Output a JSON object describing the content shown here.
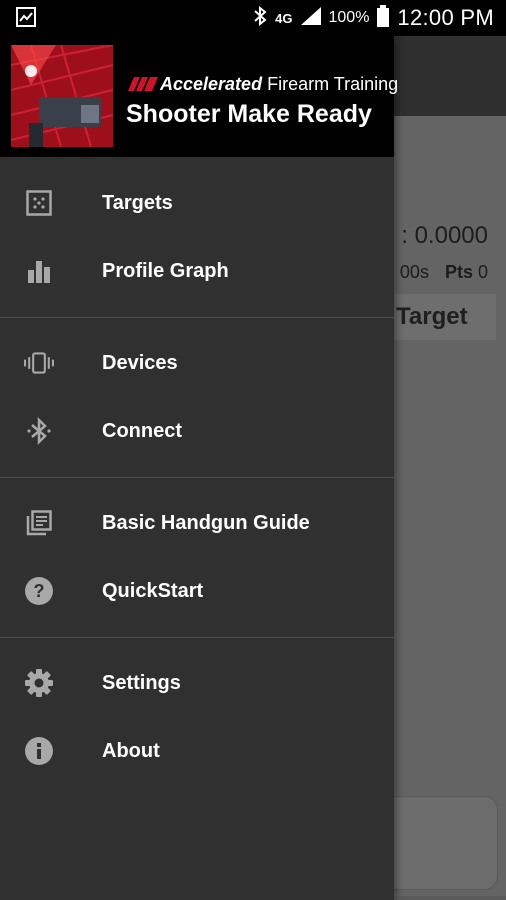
{
  "status_bar": {
    "time": "12:00 PM",
    "battery_percent": "100%",
    "network": "4G"
  },
  "background_app": {
    "readout_value": ": 0.0000",
    "sub_time": "00s",
    "points_label": "Pts",
    "points_value": "0",
    "target_button_label": "Target"
  },
  "drawer": {
    "brand_prefix": "Accelerated",
    "brand_suffix": "Firearm Training",
    "title": "Shooter Make Ready",
    "groups": [
      {
        "items": [
          {
            "label": "Targets",
            "icon": "grid-icon"
          },
          {
            "label": "Profile Graph",
            "icon": "bar-chart-icon"
          }
        ]
      },
      {
        "items": [
          {
            "label": "Devices",
            "icon": "vibrate-device-icon"
          },
          {
            "label": "Connect",
            "icon": "bluetooth-icon"
          }
        ]
      },
      {
        "items": [
          {
            "label": "Basic Handgun Guide",
            "icon": "library-books-icon"
          },
          {
            "label": "QuickStart",
            "icon": "help-circle-icon"
          }
        ]
      },
      {
        "items": [
          {
            "label": "Settings",
            "icon": "gear-icon"
          },
          {
            "label": "About",
            "icon": "info-icon"
          }
        ]
      }
    ]
  },
  "colors": {
    "drawer_bg": "#303030",
    "header_bg": "#000000",
    "brand_red": "#d0122a",
    "icon_gray": "#a8a8a8"
  }
}
